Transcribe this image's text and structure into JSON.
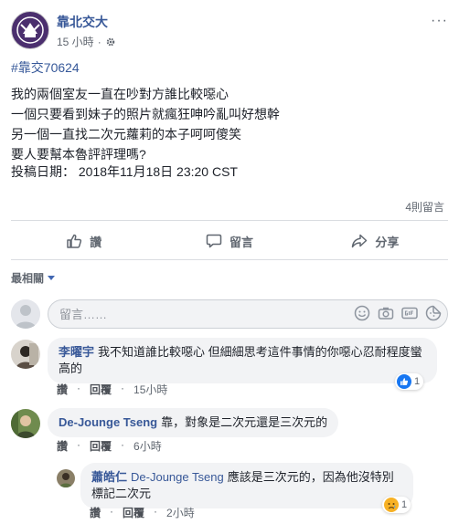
{
  "post": {
    "page_name": "靠北交大",
    "time": "15 小時",
    "privacy_icon": "gear-icon",
    "hashtag": "#靠交70624",
    "lines": [
      "我的兩個室友一直在吵對方誰比較噁心",
      "一個只要看到妹子的照片就瘋狂呻吟亂叫好想幹",
      "另一個一直找二次元蘿莉的本子呵呵傻笑",
      "要人要幫本魯評評理嗎?"
    ],
    "date_line": "投稿日期： 2018年11月18日 23:20 CST",
    "comment_count": "4則留言"
  },
  "actions": {
    "like": "讚",
    "comment": "留言",
    "share": "分享"
  },
  "sort": {
    "label": "最相關"
  },
  "composer": {
    "placeholder": "留言……"
  },
  "comments": [
    {
      "author": "李曜宇",
      "text": "我不知道誰比較噁心 但細細思考這件事情的你噁心忍耐程度蠻高的",
      "like": "讚",
      "reply": "回覆",
      "time": "15小時",
      "reaction_count": "1"
    },
    {
      "author": "De-Jounge Tseng",
      "text": "靠，對象是二次元還是三次元的",
      "like": "讚",
      "reply": "回覆",
      "time": "6小時"
    },
    {
      "author": "蕭皓仁",
      "tag": "De-Jounge Tseng",
      "text": "應該是三次元的，因為他沒特別標記二次元",
      "like": "讚",
      "reply": "回覆",
      "time": "2小時",
      "reaction_count": "1"
    }
  ],
  "colors": {
    "link": "#385898",
    "hashtag": "#365899",
    "bubble": "#f2f3f5",
    "like_blue": "#1877f2"
  }
}
